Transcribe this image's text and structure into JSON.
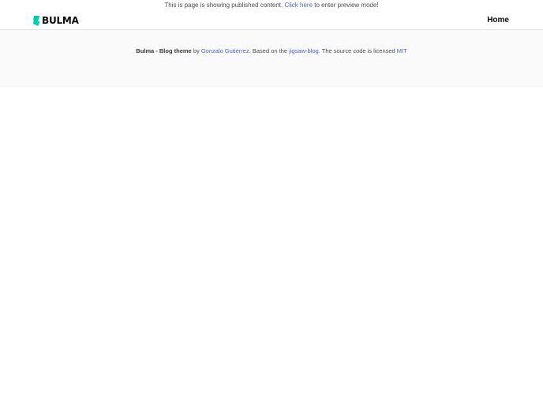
{
  "banner": {
    "text_before": "This is page is showing published content.",
    "link_label": "Click here",
    "text_after": "to enter preview mode!"
  },
  "navbar": {
    "brand_text": "BULMA",
    "home_label": "Home"
  },
  "footer": {
    "title": "Bulma - Blog theme",
    "by": "by",
    "author_link": "Gonzalo Gutierrez",
    "based_on": ". Based on the",
    "project_link": "jigsaw-blog",
    "license_text": ". The source code is licensed",
    "license_link": "MIT"
  },
  "colors": {
    "link": "#485fc7",
    "brand": "#00d1b2",
    "footer_bg": "#fafafa"
  },
  "icons": {
    "brand_logo": "bulma-logo-icon"
  }
}
